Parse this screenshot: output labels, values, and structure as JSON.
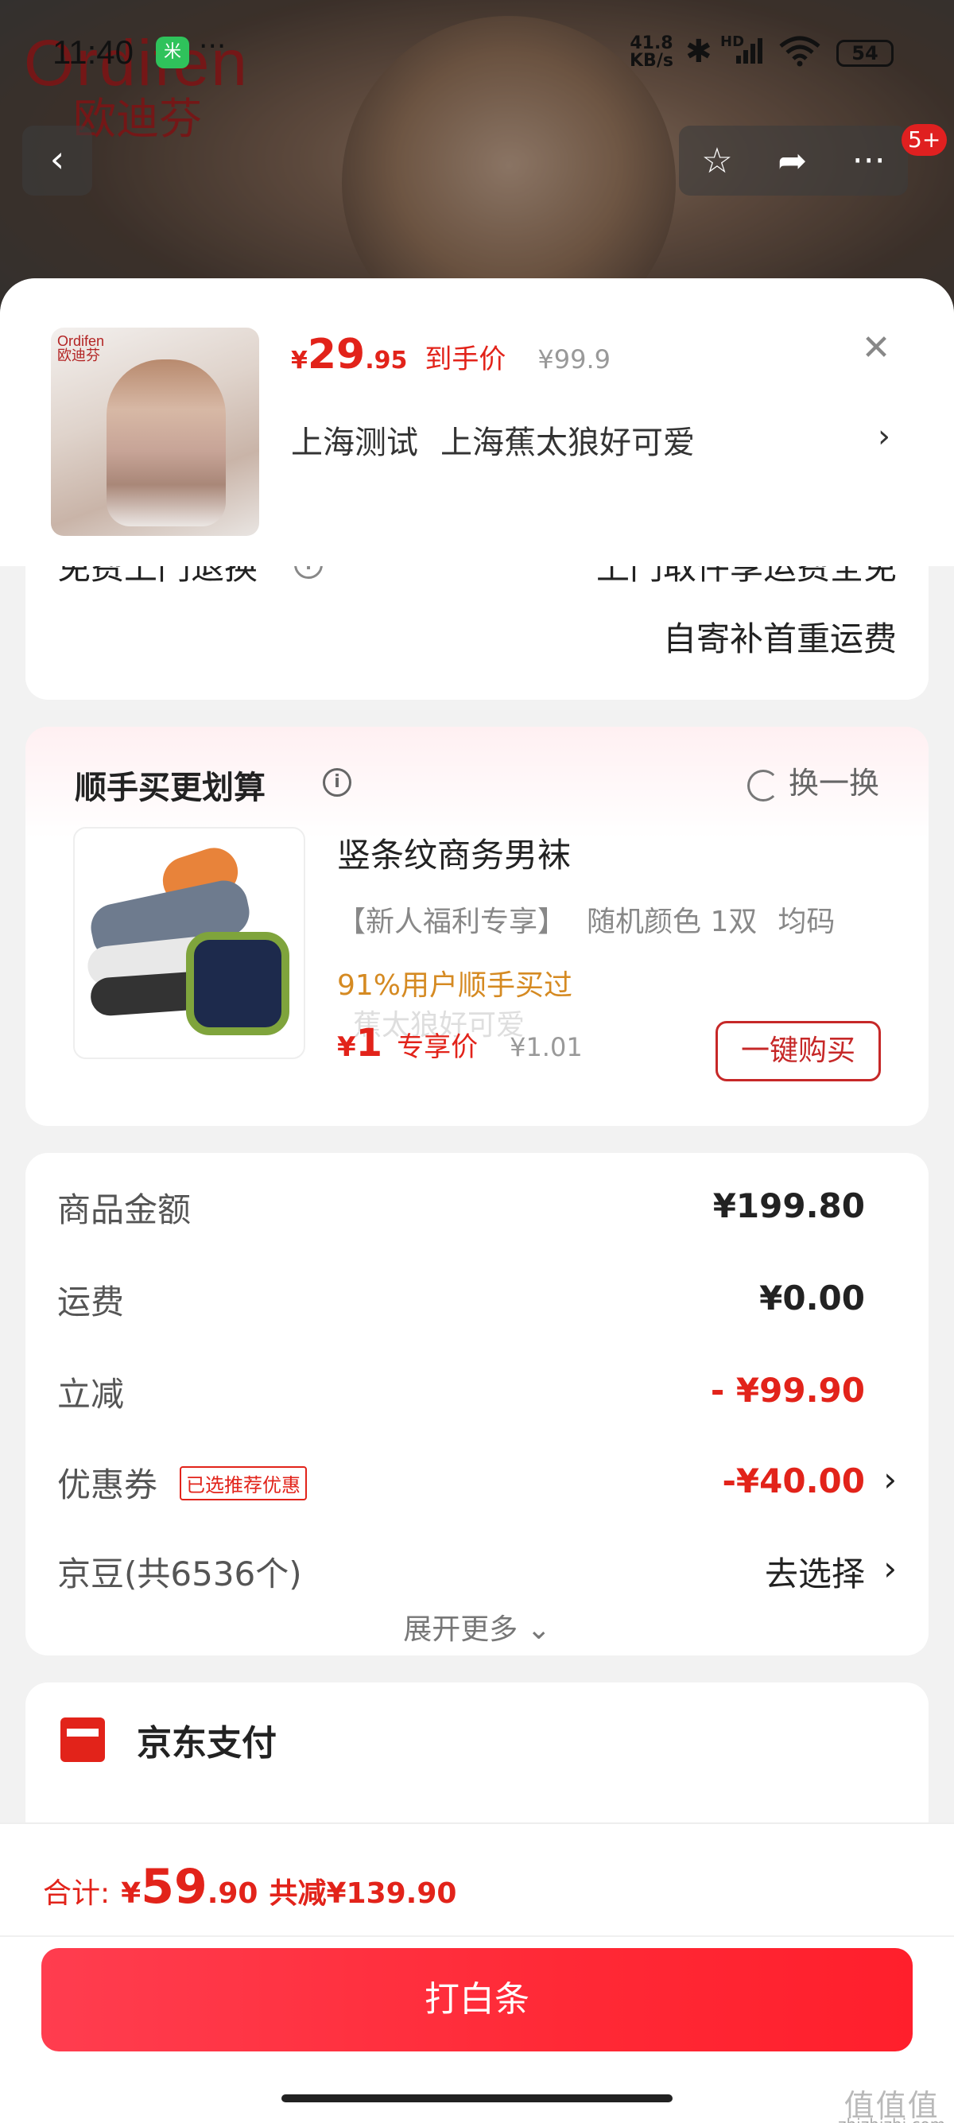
{
  "status_bar": {
    "time": "11:40",
    "app_badge": "米",
    "dots": "···",
    "net_speed": "41.8",
    "net_unit": "KB/s",
    "hd": "HD",
    "battery": "54"
  },
  "brand": {
    "logo_en": "Ordifen",
    "logo_cn": "欧迪芬"
  },
  "top_nav": {
    "badge": "5+"
  },
  "product_header": {
    "thumb_logo_en": "Ordifen",
    "thumb_logo_cn": "欧迪芬",
    "price_symbol": "¥",
    "price_int": "29",
    "price_dec": ".95",
    "price_tag": "到手价",
    "original_price": "¥99.9",
    "address_city": "上海测试",
    "address_name": "上海蕉太狼好可爱"
  },
  "return_service": {
    "label": "免费上门退换",
    "line1": "上门取件享运费全免",
    "line2": "自寄补首重运费"
  },
  "addon": {
    "title": "顺手买更划算",
    "swap_label": "换一换",
    "product_name": "竖条纹商务男袜",
    "spec_tag": "【新人福利专享】",
    "spec_color": "随机颜色 1双",
    "spec_size": "均码",
    "bought": "91%用户顺手买过",
    "watermark": "蕉太狼好可爱",
    "price_symbol": "¥",
    "price": "1",
    "price_tag": "专享价",
    "original_price": "¥1.01",
    "buy_button": "一键购买"
  },
  "summary": {
    "rows": [
      {
        "label": "商品金额",
        "value": "¥199.80"
      },
      {
        "label": "运费",
        "value": "¥0.00"
      },
      {
        "label": "立减",
        "value": "- ¥99.90"
      },
      {
        "label": "优惠券",
        "badge": "已选推荐优惠",
        "value": "-¥40.00"
      },
      {
        "label": "京豆(共6536个)",
        "value": "去选择"
      }
    ],
    "expand_more": "展开更多 ⌄"
  },
  "payment_method": {
    "label": "京东支付"
  },
  "bottom_bar": {
    "total_label": "合计:",
    "total_symbol": "¥",
    "total_int": "59",
    "total_dec": ".90",
    "saved": "共减¥139.90",
    "pay_button": "打白条"
  },
  "watermark": {
    "line1": "值值值",
    "line2": "zhizhizhi.com"
  },
  "colors": {
    "accent_red": "#e2231a",
    "button_red": "#ff2936",
    "bought_orange": "#d58a22"
  }
}
